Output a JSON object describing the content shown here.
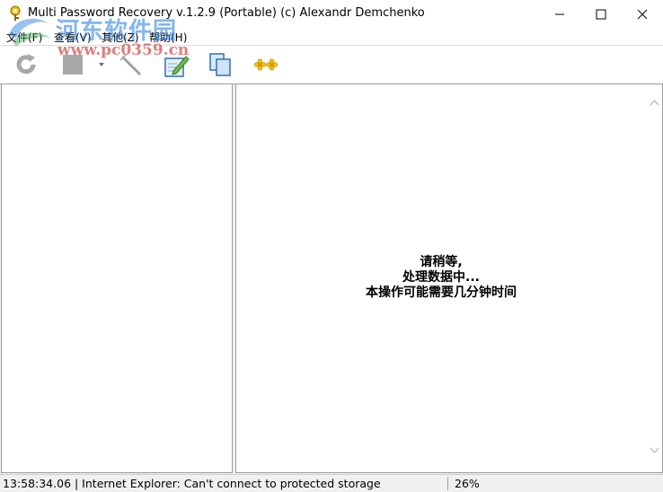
{
  "window": {
    "title": "Multi Password Recovery v.1.2.9 (Portable) (c) Alexandr Demchenko"
  },
  "watermark": {
    "line1": "河东软件园",
    "line2": "www.pc0359.cn"
  },
  "menu": {
    "items": [
      {
        "label": "文件(F)"
      },
      {
        "label": "查看(V)"
      },
      {
        "label": "其他(Z)"
      },
      {
        "label": "帮助(H)"
      }
    ]
  },
  "toolbar": {
    "icons": [
      "refresh-icon",
      "stop-icon",
      "dropdown-arrow-icon",
      "wand-icon",
      "edit-icon",
      "copy-icon",
      "flower-icon"
    ]
  },
  "content": {
    "wait_line1": "请稍等,",
    "wait_line2": "处理数据中...",
    "wait_line3": "本操作可能需要几分钟时间"
  },
  "status": {
    "message": "13:58:34.06 | Internet Explorer: Can't connect to protected storage",
    "progress_text": "26%",
    "progress": 0.26
  }
}
